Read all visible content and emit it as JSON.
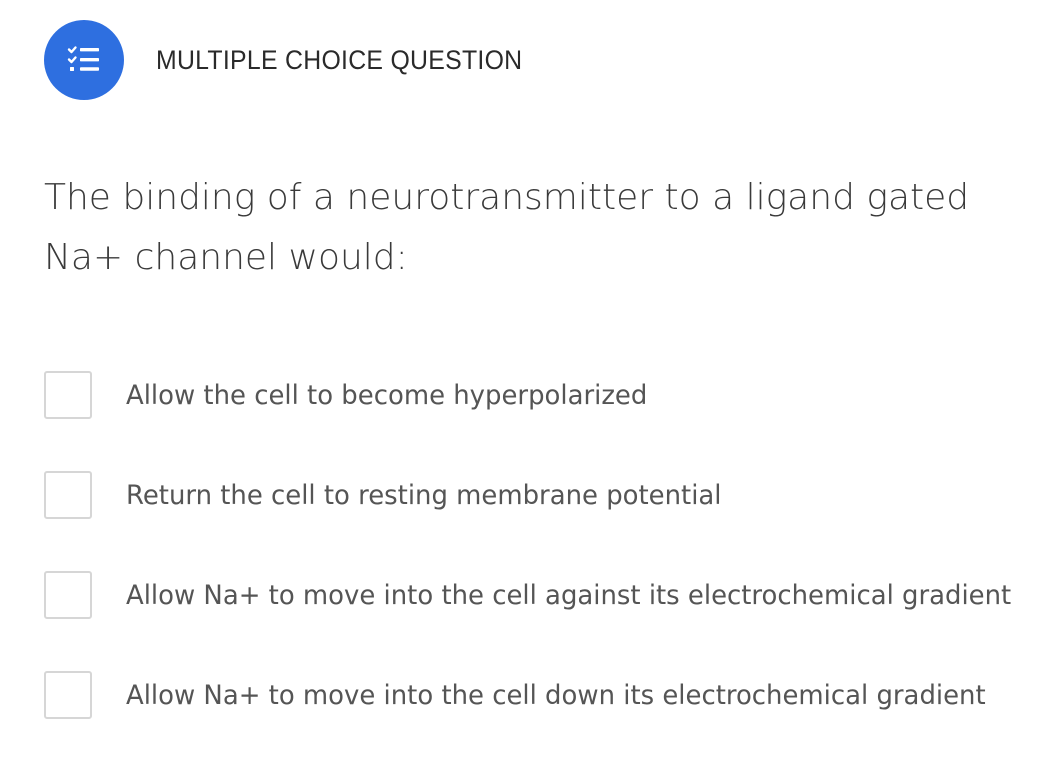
{
  "header": {
    "icon": "checklist-icon",
    "type_label": "MULTIPLE CHOICE QUESTION"
  },
  "question": {
    "text": "The binding of a neurotransmitter to a ligand gated Na+ channel would:"
  },
  "options": [
    {
      "label": "Allow the cell to become hyperpolarized",
      "checked": false
    },
    {
      "label": "Return the cell to resting membrane potential",
      "checked": false
    },
    {
      "label": "Allow Na+ to move into the cell against its electrochemical gradient",
      "checked": false
    },
    {
      "label": "Allow Na+ to move into the cell down its electrochemical gradient",
      "checked": false
    }
  ],
  "colors": {
    "accent": "#2e6fe0",
    "checkbox_border": "#d6d6d6",
    "question_text": "#3a3a3a",
    "option_text": "#555555"
  }
}
